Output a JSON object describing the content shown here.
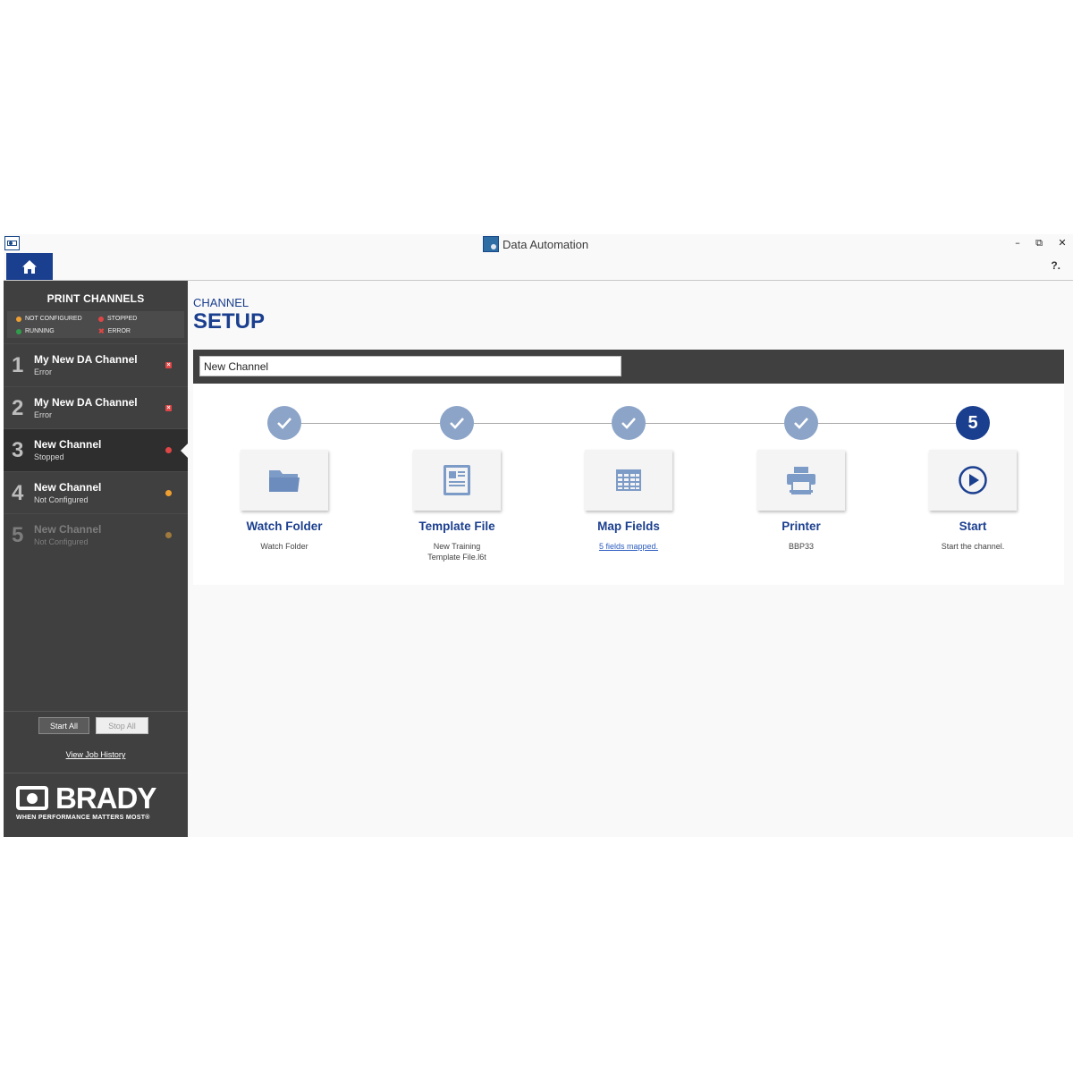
{
  "window": {
    "title": "Data Automation",
    "help_label": "?."
  },
  "sidebar": {
    "title": "PRINT CHANNELS",
    "legend": [
      {
        "label": "NOT CONFIGURED",
        "color": "#f0a030",
        "kind": "dot"
      },
      {
        "label": "STOPPED",
        "color": "#e04646",
        "kind": "dot"
      },
      {
        "label": "RUNNING",
        "color": "#2e9e4a",
        "kind": "dot"
      },
      {
        "label": "ERROR",
        "color": "#e04646",
        "kind": "x"
      }
    ],
    "channels": [
      {
        "number": "1",
        "name": "My New DA Channel",
        "status": "Error",
        "indicator": "error"
      },
      {
        "number": "2",
        "name": "My New DA Channel",
        "status": "Error",
        "indicator": "error"
      },
      {
        "number": "3",
        "name": "New Channel",
        "status": "Stopped",
        "indicator": "stopped"
      },
      {
        "number": "4",
        "name": "New Channel",
        "status": "Not Configured",
        "indicator": "not-configured"
      },
      {
        "number": "5",
        "name": "New Channel",
        "status": "Not Configured",
        "indicator": "not-configured"
      }
    ],
    "start_all_label": "Start All",
    "stop_all_label": "Stop All",
    "view_history_label": "View Job History",
    "logo": {
      "wordmark": "BRADY",
      "tagline": "WHEN PERFORMANCE MATTERS MOST®"
    }
  },
  "main": {
    "crumb": "CHANNEL",
    "title": "SETUP",
    "channel_name": "New Channel",
    "accent_color": "#1b3f8f",
    "steps": [
      {
        "title": "Watch Folder",
        "subtitle": "Watch Folder",
        "icon": "folder-icon",
        "state": "done"
      },
      {
        "title": "Template File",
        "subtitle": "New Training Template File.l6t",
        "icon": "document-icon",
        "state": "done"
      },
      {
        "title": "Map Fields",
        "subtitle": "5 fields mapped.",
        "icon": "grid-icon",
        "state": "done",
        "link": true
      },
      {
        "title": "Printer",
        "subtitle": "BBP33",
        "icon": "printer-icon",
        "state": "done"
      },
      {
        "title": "Start",
        "subtitle": "Start the channel.",
        "icon": "play-icon",
        "state": "current",
        "number": "5"
      }
    ]
  }
}
